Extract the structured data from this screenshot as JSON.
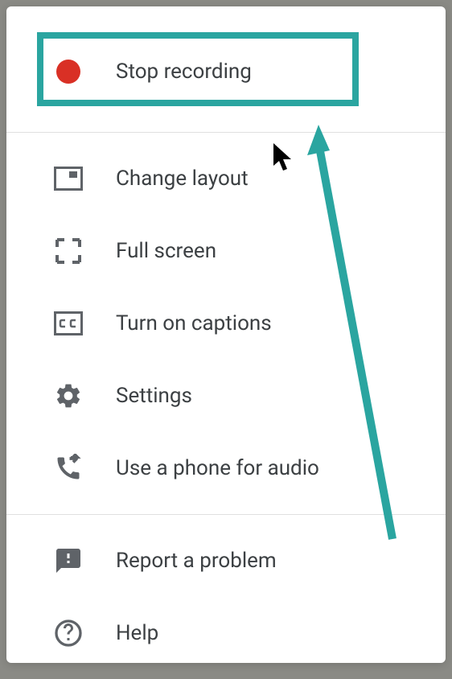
{
  "menu": {
    "sections": [
      {
        "items": [
          {
            "id": "stop-recording",
            "label": "Stop recording"
          }
        ]
      },
      {
        "items": [
          {
            "id": "change-layout",
            "label": "Change layout"
          },
          {
            "id": "full-screen",
            "label": "Full screen"
          },
          {
            "id": "turn-on-captions",
            "label": "Turn on captions"
          },
          {
            "id": "settings",
            "label": "Settings"
          },
          {
            "id": "phone-audio",
            "label": "Use a phone for audio"
          }
        ]
      },
      {
        "items": [
          {
            "id": "report-problem",
            "label": "Report a problem"
          },
          {
            "id": "help",
            "label": "Help"
          }
        ]
      }
    ]
  },
  "colors": {
    "highlight": "#2aa5a0",
    "record": "#d93025",
    "iconGray": "#5f6368",
    "textGray": "#3c4043"
  }
}
